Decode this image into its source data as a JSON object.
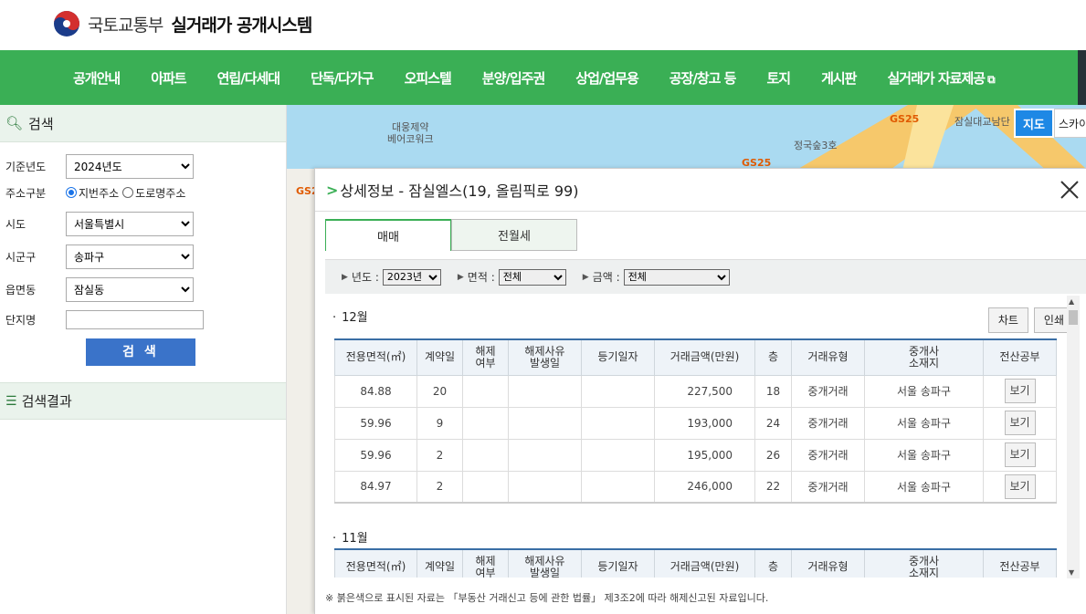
{
  "header": {
    "ministry": "국토교통부",
    "system_name": "실거래가 공개시스템",
    "nav": [
      "공개안내",
      "아파트",
      "연립/다세대",
      "단독/다가구",
      "오피스텔",
      "분양/입주권",
      "상업/업무용",
      "공장/창고 등",
      "토지",
      "게시판",
      "실거래가 자료제공"
    ]
  },
  "sidebar": {
    "search_title": "검색",
    "year_label": "기준년도",
    "year_value": "2024년도",
    "addr_type_label": "주소구분",
    "addr_opt1": "지번주소",
    "addr_opt2": "도로명주소",
    "sido_label": "시도",
    "sido_value": "서울특별시",
    "sigungu_label": "시군구",
    "sigungu_value": "송파구",
    "dong_label": "읍면동",
    "dong_value": "잠실동",
    "complex_label": "단지명",
    "complex_value": "",
    "search_button": "검 색",
    "results_title": "검색결과"
  },
  "map": {
    "view_button": "지도",
    "view_button2": "스카이",
    "labels": [
      "대웅제약",
      "베어코워크",
      "정국숲3호",
      "잠실대교남단"
    ],
    "gs_labels": [
      "GS25",
      "GS25",
      "GS2"
    ]
  },
  "detail": {
    "title": "상세정보 - 잠실엘스(19, 올림픽로 99)",
    "tab_sale": "매매",
    "tab_rent": "전월세",
    "filter_year_label": "년도 :",
    "filter_year_value": "2023년",
    "filter_area_label": "면적 :",
    "filter_area_value": "전체",
    "filter_price_label": "금액 :",
    "filter_price_value": "전체",
    "chart_button": "차트",
    "print_button": "인쇄",
    "columns": [
      "전용면적(㎡)",
      "계약일",
      "해제\n여부",
      "해제사유\n발생일",
      "등기일자",
      "거래금액(만원)",
      "층",
      "거래유형",
      "중개사\n소재지",
      "전산공부"
    ],
    "view_label": "보기",
    "months": [
      {
        "label": "12월",
        "rows": [
          {
            "area": "84.88",
            "day": "20",
            "cancel": "",
            "cancel_date": "",
            "reg_date": "",
            "price": "227,500",
            "floor": "18",
            "type": "중개거래",
            "broker": "서울 송파구"
          },
          {
            "area": "59.96",
            "day": "9",
            "cancel": "",
            "cancel_date": "",
            "reg_date": "",
            "price": "193,000",
            "floor": "24",
            "type": "중개거래",
            "broker": "서울 송파구"
          },
          {
            "area": "59.96",
            "day": "2",
            "cancel": "",
            "cancel_date": "",
            "reg_date": "",
            "price": "195,000",
            "floor": "26",
            "type": "중개거래",
            "broker": "서울 송파구"
          },
          {
            "area": "84.97",
            "day": "2",
            "cancel": "",
            "cancel_date": "",
            "reg_date": "",
            "price": "246,000",
            "floor": "22",
            "type": "중개거래",
            "broker": "서울 송파구"
          }
        ]
      },
      {
        "label": "11월",
        "rows": []
      }
    ],
    "footnote": "※ 붉은색으로 표시된 자료는 「부동산 거래신고 등에 관한 법률」 제3조2에 따라 해제신고된 자료입니다."
  }
}
